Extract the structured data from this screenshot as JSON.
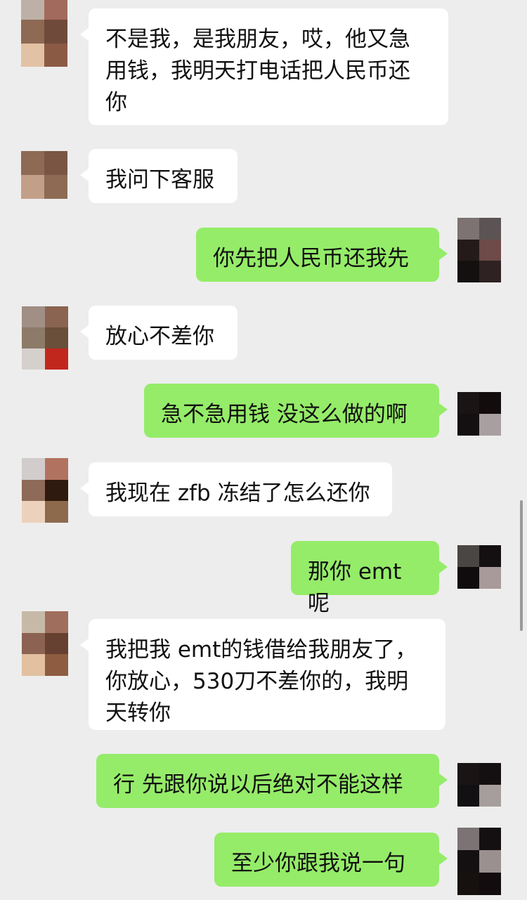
{
  "messages": [
    {
      "side": "left",
      "text": "不是我，是我朋友，哎，他又急用钱，我明天打电话把人民币还你",
      "avatar": [
        "#bdb1a7",
        "#a26a5c",
        "#8e6a54",
        "#6f4a3a",
        "#e2c2a4",
        "#8b5a45"
      ]
    },
    {
      "side": "left",
      "text": "我问下客服",
      "avatar": [
        "#8e6a54",
        "#7a5544",
        "#c2a088",
        "#8e6a54"
      ]
    },
    {
      "side": "right",
      "text": "你先把人民币还我先",
      "avatar": [
        "#7d7373",
        "#5c5454",
        "#241a1a",
        "#6e4a48",
        "#141010",
        "#2e2222"
      ]
    },
    {
      "side": "left",
      "text": "放心不差你",
      "avatar": [
        "#a18e85",
        "#8a6450",
        "#8e7a68",
        "#6a4f3a",
        "#d6d0cc",
        "#c2271d"
      ]
    },
    {
      "side": "right",
      "text": "急不急用钱 没这么做的啊",
      "avatar": [
        "#1a1414",
        "#120c0c",
        "#141012",
        "#a8a0a0"
      ]
    },
    {
      "side": "left",
      "text": "我现在 zfb 冻结了怎么还你",
      "avatar": [
        "#d2cccc",
        "#b27260",
        "#8e6a58",
        "#2e1a0e",
        "#ecd2bc",
        "#8e6a4c"
      ]
    },
    {
      "side": "right",
      "text": "那你 emt呢",
      "avatar": [
        "#4a4644",
        "#141012",
        "#100c0e",
        "#a89a9a"
      ]
    },
    {
      "side": "left",
      "text": "我把我 emt的钱借给我朋友了，你放心，530刀不差你的，我明天转你",
      "avatar": [
        "#c7b9a7",
        "#a06e5c",
        "#8c6252",
        "#664030",
        "#e2c0a0",
        "#8e5c40"
      ]
    },
    {
      "side": "right",
      "text": "行 先跟你说以后绝对不能这样",
      "avatar": [
        "#1a1414",
        "#141012",
        "#121012",
        "#a69e9c"
      ]
    },
    {
      "side": "right",
      "text": "至少你跟我说一句",
      "avatar": [
        "#7c7474",
        "#141012",
        "#141012",
        "#9a9090",
        "#16100e",
        "#120c0e"
      ]
    }
  ]
}
